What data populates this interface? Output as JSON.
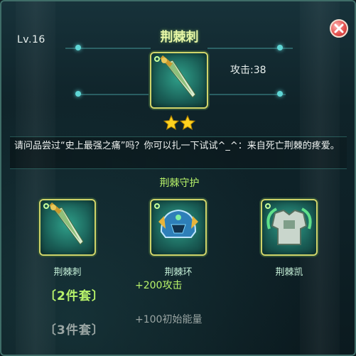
{
  "item": {
    "level": "Lv.16",
    "name": "荆棘刺",
    "attack": "攻击:38",
    "stars": 2,
    "description": "请问品尝过“史上最强之痛”吗？你可以扎一下试试^_^：来自死亡荆棘的疼爱。"
  },
  "set": {
    "title": "荆棘守护",
    "pieces": [
      {
        "name": "荆棘刺",
        "icon": "dagger-icon"
      },
      {
        "name": "荆棘环",
        "icon": "helmet-icon"
      },
      {
        "name": "荆棘凯",
        "icon": "armor-icon"
      }
    ],
    "bonuses": [
      {
        "tier": "〔2件套〕",
        "effect": "+200攻击",
        "active": true
      },
      {
        "tier": "〔3件套〕",
        "effect": "+100初始能量",
        "active": false
      }
    ]
  },
  "ui": {
    "close_icon": "close-icon",
    "colors": {
      "title": "#e8f7a7",
      "set_title": "#b8f36a",
      "active_bonus": "#b8f36a",
      "inactive_bonus": "#9aa5a3",
      "star": "#ffd21f"
    }
  }
}
